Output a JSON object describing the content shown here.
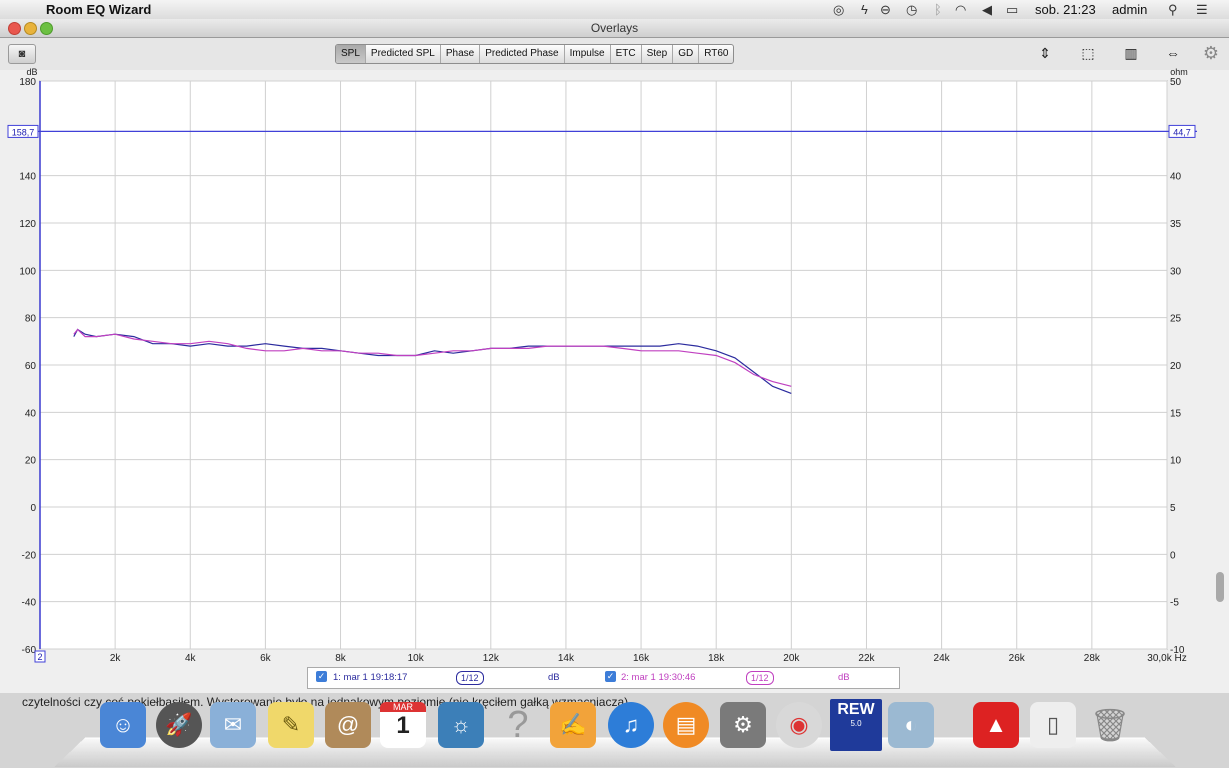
{
  "menubar": {
    "app_name": "Room EQ Wizard",
    "clock": "sob. 21:23",
    "user": "admin",
    "icons": [
      "creative-cloud-icon",
      "flash-icon",
      "sync-icon",
      "time-machine-icon",
      "bluetooth-icon",
      "wifi-icon",
      "volume-icon",
      "battery-icon",
      "spotlight-icon",
      "notification-icon"
    ]
  },
  "window": {
    "title": "Overlays",
    "tabs": [
      {
        "label": "SPL",
        "active": true
      },
      {
        "label": "Predicted SPL",
        "active": false
      },
      {
        "label": "Phase",
        "active": false
      },
      {
        "label": "Predicted Phase",
        "active": false
      },
      {
        "label": "Impulse",
        "active": false
      },
      {
        "label": "ETC",
        "active": false
      },
      {
        "label": "Step",
        "active": false
      },
      {
        "label": "GD",
        "active": false
      },
      {
        "label": "RT60",
        "active": false
      }
    ]
  },
  "chart_data": {
    "type": "line",
    "xlabel": "Hz",
    "ylabel_left": "dB",
    "ylabel_right": "ohm",
    "xlim": [
      0,
      30000
    ],
    "ylim": [
      -60,
      180
    ],
    "ylim_right": [
      -10,
      50
    ],
    "x_ticks": [
      "2k",
      "4k",
      "6k",
      "8k",
      "10k",
      "12k",
      "14k",
      "16k",
      "18k",
      "20k",
      "22k",
      "24k",
      "26k",
      "28k",
      "30,0k Hz"
    ],
    "x_tick_values": [
      2000,
      4000,
      6000,
      8000,
      10000,
      12000,
      14000,
      16000,
      18000,
      20000,
      22000,
      24000,
      26000,
      28000,
      30000
    ],
    "x_min_label": "2",
    "y_ticks_left": [
      "180",
      "140",
      "120",
      "100",
      "80",
      "60",
      "40",
      "20",
      "0",
      "-20",
      "-40",
      "-60"
    ],
    "y_tick_values_left": [
      180,
      140,
      120,
      100,
      80,
      60,
      40,
      20,
      0,
      -20,
      -40,
      -60
    ],
    "y_ticks_right": [
      "50",
      "40",
      "35",
      "30",
      "25",
      "20",
      "15",
      "10",
      "5",
      "0",
      "-5",
      "-10"
    ],
    "y_tick_values_right": [
      50,
      40,
      35,
      30,
      25,
      20,
      15,
      10,
      5,
      0,
      -5,
      -10
    ],
    "cursor_left": "158,7",
    "cursor_right": "44,7",
    "cursor_value_db": 158.7,
    "grid": true,
    "series": [
      {
        "name": "1: mar 1 19:18:17",
        "color": "#2b2b9e",
        "x": [
          900,
          1000,
          1200,
          1500,
          2000,
          2500,
          3000,
          3500,
          4000,
          4500,
          5000,
          5500,
          6000,
          6500,
          7000,
          7500,
          8000,
          8500,
          9000,
          9500,
          10000,
          10500,
          11000,
          11500,
          12000,
          12500,
          13000,
          13500,
          14000,
          14500,
          15000,
          15500,
          16000,
          16500,
          17000,
          17500,
          18000,
          18500,
          19000,
          19500,
          20000
        ],
        "y": [
          72,
          75,
          73,
          72,
          73,
          72,
          69,
          69,
          68,
          69,
          68,
          68,
          69,
          68,
          67,
          67,
          66,
          65,
          64,
          64,
          64,
          66,
          65,
          66,
          67,
          67,
          68,
          68,
          68,
          68,
          68,
          68,
          68,
          68,
          69,
          68,
          66,
          63,
          57,
          51,
          48
        ]
      },
      {
        "name": "2: mar 1 19:30:46",
        "color": "#c040c0",
        "x": [
          900,
          1000,
          1200,
          1500,
          2000,
          2500,
          3000,
          3500,
          4000,
          4500,
          5000,
          5500,
          6000,
          6500,
          7000,
          7500,
          8000,
          8500,
          9000,
          9500,
          10000,
          10500,
          11000,
          11500,
          12000,
          12500,
          13000,
          13500,
          14000,
          14500,
          15000,
          15500,
          16000,
          16500,
          17000,
          17500,
          18000,
          18500,
          19000,
          19500,
          20000
        ],
        "y": [
          73,
          75,
          72,
          72,
          73,
          71,
          70,
          69,
          69,
          70,
          69,
          67,
          66,
          66,
          67,
          66,
          66,
          65,
          65,
          64,
          64,
          65,
          66,
          66,
          67,
          67,
          67,
          68,
          68,
          68,
          68,
          67,
          66,
          66,
          66,
          65,
          64,
          61,
          56,
          53,
          51
        ]
      }
    ]
  },
  "legend": {
    "items": [
      {
        "label": "1: mar 1 19:18:17",
        "smoothing": "1/12",
        "unit": "dB"
      },
      {
        "label": "2: mar 1 19:30:46",
        "smoothing": "1/12",
        "unit": "dB"
      }
    ]
  },
  "desktop_text": "czytelności czy coś pokiełbasiłem. Wysterowanie było na jednakowym poziomie (nie kręciłem gałką wzmacniacza).",
  "dock": {
    "items": [
      "finder-icon",
      "launchpad-icon",
      "mail-icon",
      "notes-icon",
      "contacts-icon",
      "calendar-icon",
      "iphoto-icon",
      "image-capture-icon",
      "help-icon",
      "pages-icon",
      "itunes-icon",
      "ibooks-icon",
      "system-preferences-icon",
      "chrome-icon",
      "rew-icon",
      "preview-icon",
      "adobe-air-icon",
      "file-icon",
      "trash-icon"
    ],
    "calendar_month": "MAR",
    "calendar_day": "1",
    "rew_label": "REW",
    "rew_version": "5.0"
  }
}
